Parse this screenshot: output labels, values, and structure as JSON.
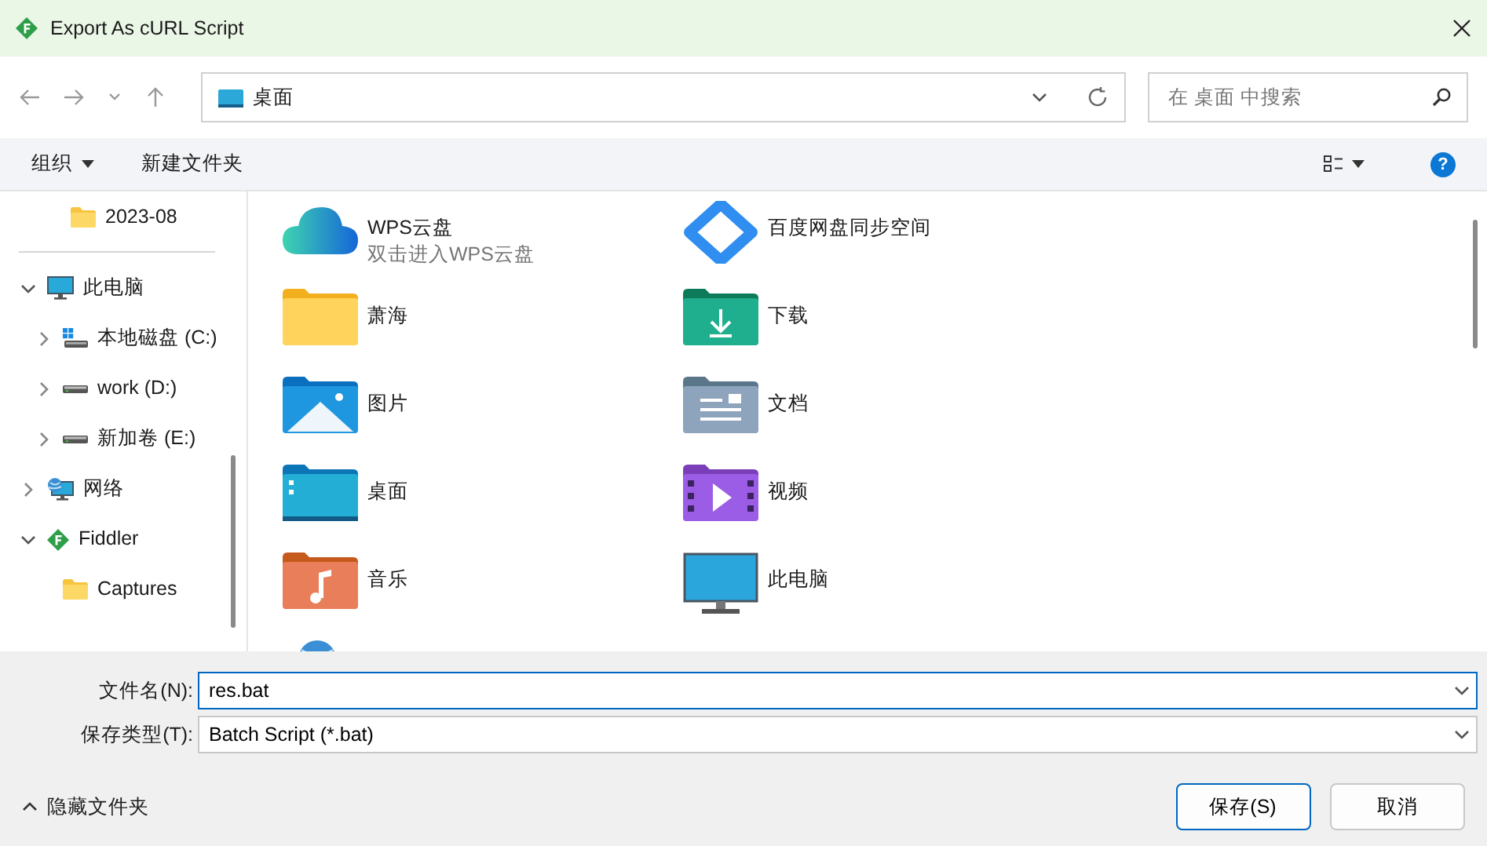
{
  "window": {
    "title": "Export As cURL Script"
  },
  "address_bar": {
    "path": "桌面"
  },
  "search": {
    "placeholder": "在 桌面 中搜索"
  },
  "toolbar": {
    "organize": "组织",
    "new_folder": "新建文件夹",
    "help": "?"
  },
  "sidebar": {
    "items": [
      {
        "label": "2023-08",
        "kind": "folder"
      },
      {
        "kind": "divider"
      },
      {
        "label": "此电脑",
        "kind": "computer",
        "expanded": true,
        "children": [
          {
            "label": "本地磁盘 (C:)",
            "kind": "system-drive",
            "expanded": false
          },
          {
            "label": "work (D:)",
            "kind": "drive",
            "expanded": false
          },
          {
            "label": "新加卷 (E:)",
            "kind": "drive",
            "expanded": false
          }
        ]
      },
      {
        "label": "网络",
        "kind": "network",
        "expanded": false
      },
      {
        "label": "Fiddler",
        "kind": "app",
        "expanded": true,
        "children": [
          {
            "label": "Captures",
            "kind": "folder"
          }
        ]
      }
    ]
  },
  "items": [
    {
      "label": "WPS云盘",
      "subtitle": "双击进入WPS云盘",
      "kind": "cloud"
    },
    {
      "label": "百度网盘同步空间",
      "kind": "sync"
    },
    {
      "label": "萧海",
      "kind": "folder"
    },
    {
      "label": "下载",
      "kind": "downloads"
    },
    {
      "label": "图片",
      "kind": "pictures"
    },
    {
      "label": "文档",
      "kind": "documents"
    },
    {
      "label": "桌面",
      "kind": "desktop"
    },
    {
      "label": "视频",
      "kind": "videos"
    },
    {
      "label": "音乐",
      "kind": "music"
    },
    {
      "label": "此电脑",
      "kind": "computer"
    },
    {
      "kind": "network"
    }
  ],
  "form": {
    "filename_label": "文件名(N):",
    "filename": "res.bat",
    "type_label": "保存类型(T):",
    "type": "Batch Script (*.bat)"
  },
  "footer": {
    "hide_folders": "隐藏文件夹",
    "save": "保存(S)",
    "cancel": "取消"
  }
}
